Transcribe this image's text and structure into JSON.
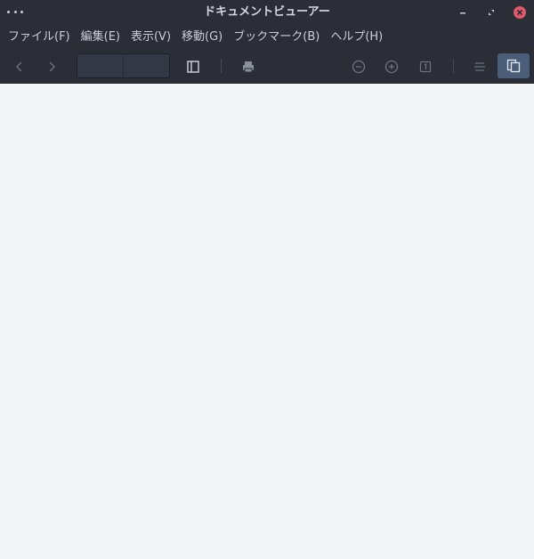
{
  "window": {
    "title": "ドキュメントビューアー"
  },
  "menubar": {
    "items": [
      {
        "label": "ファイル(F)"
      },
      {
        "label": "編集(E)"
      },
      {
        "label": "表示(V)"
      },
      {
        "label": "移動(G)"
      },
      {
        "label": "ブックマーク(B)"
      },
      {
        "label": "ヘルプ(H)"
      }
    ]
  },
  "toolbar": {
    "page_number": "",
    "page_count": "",
    "icons": {
      "back": "chevron-left-icon",
      "forward": "chevron-right-icon",
      "sidebar": "sidebar-icon",
      "print": "printer-icon",
      "zoom_out": "zoom-out-icon",
      "zoom_in": "zoom-in-icon",
      "fit_page": "fit-page-icon",
      "continuous": "continuous-icon",
      "dual": "dual-page-icon"
    }
  },
  "colors": {
    "chrome": "#2b2e37",
    "content": "#f4f5f7",
    "accent": "#4a5d79",
    "close": "#e0566a"
  }
}
